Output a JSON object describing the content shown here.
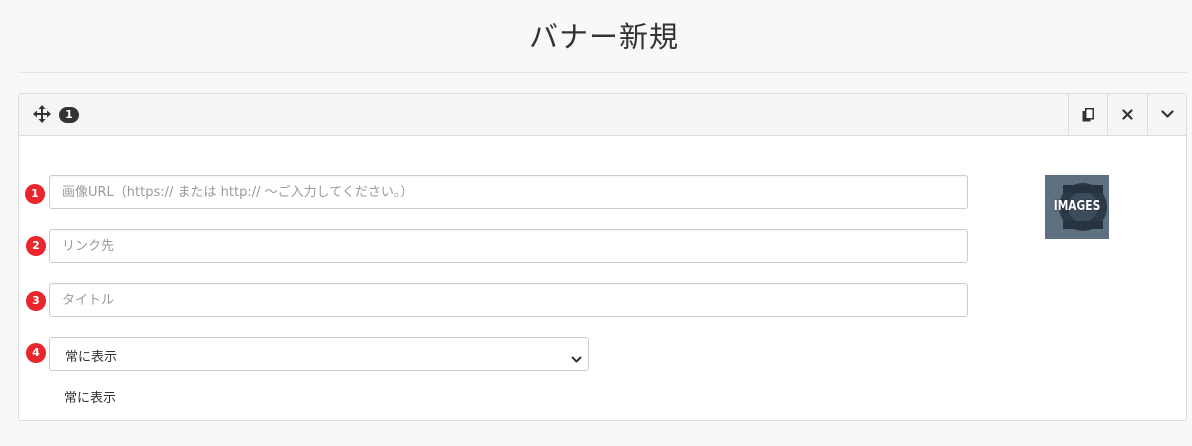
{
  "page": {
    "title": "バナー新規"
  },
  "panel": {
    "badge_count": "1",
    "icons": {
      "move": "move-arrows-icon",
      "copy": "copy-icon",
      "close": "close-icon",
      "toggle": "chevron-down-icon"
    },
    "fields": [
      {
        "number": "1",
        "placeholder": "画像URL（https:// または http:// ～ご入力してください。）",
        "value": ""
      },
      {
        "number": "2",
        "placeholder": "リンク先",
        "value": ""
      },
      {
        "number": "3",
        "placeholder": "タイトル",
        "value": ""
      }
    ],
    "display": {
      "number": "4",
      "selected": "常に表示",
      "status": "常に表示"
    },
    "thumbnail": {
      "text": "IMAGES"
    }
  },
  "colors": {
    "badge_red": "#e8262b",
    "badge_dark": "#333333",
    "thumbnail_bg": "#5f7080"
  }
}
